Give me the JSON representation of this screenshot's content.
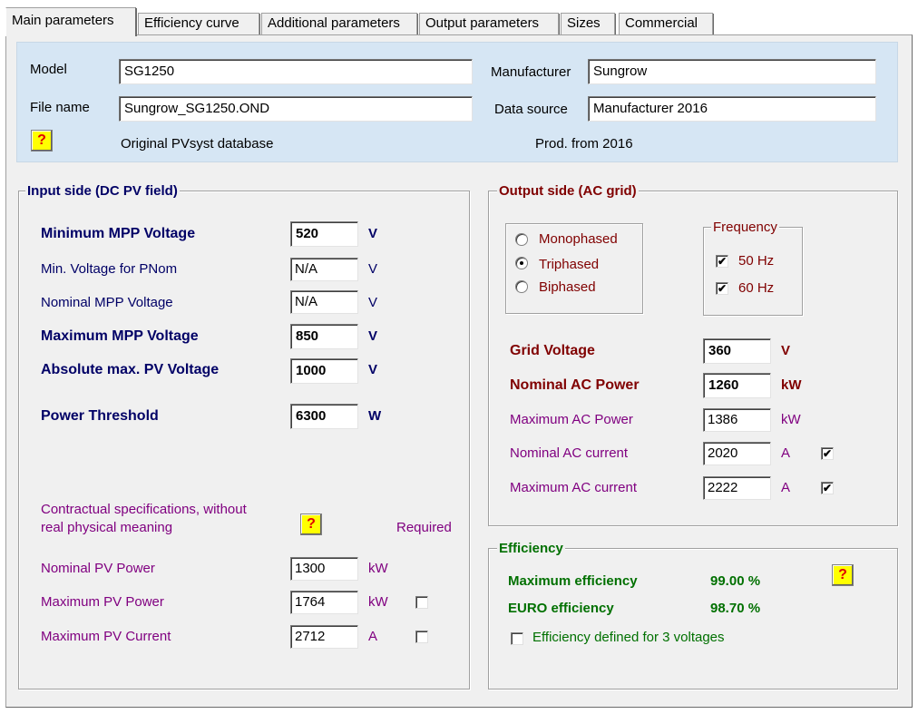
{
  "tabs": [
    {
      "label": "Main parameters"
    },
    {
      "label": "Efficiency curve"
    },
    {
      "label": "Additional parameters"
    },
    {
      "label": "Output parameters"
    },
    {
      "label": "Sizes"
    },
    {
      "label": "Commercial"
    }
  ],
  "header": {
    "model_label": "Model",
    "model_value": "SG1250",
    "manufacturer_label": "Manufacturer",
    "manufacturer_value": "Sungrow",
    "file_label": "File name",
    "file_value": "Sungrow_SG1250.OND",
    "source_label": "Data source",
    "source_value": "Manufacturer 2016",
    "origin_text": "Original PVsyst database",
    "prod_text": "Prod. from 2016",
    "help": "?"
  },
  "input_side": {
    "title": "Input side (DC PV field)",
    "rows": [
      {
        "label": "Minimum MPP Voltage",
        "value": "520",
        "unit": "V"
      },
      {
        "label": "Min. Voltage for PNom",
        "value": "N/A",
        "unit": "V"
      },
      {
        "label": "Nominal  MPP Voltage",
        "value": "N/A",
        "unit": "V"
      },
      {
        "label": "Maximum MPP Voltage",
        "value": "850",
        "unit": "V"
      },
      {
        "label": "Absolute max. PV Voltage",
        "value": "1000",
        "unit": "V"
      },
      {
        "label": "Power Threshold",
        "value": "6300",
        "unit": "W"
      }
    ],
    "contract_text_1": "Contractual specifications,  without",
    "contract_text_2": "real physical meaning",
    "required_label": "Required",
    "help": "?",
    "contract_rows": [
      {
        "label": "Nominal PV Power",
        "value": "1300",
        "unit": "kW"
      },
      {
        "label": "Maximum PV Power",
        "value": "1764",
        "unit": "kW",
        "required": false
      },
      {
        "label": "Maximum PV Current",
        "value": "2712",
        "unit": "A",
        "required": false
      }
    ]
  },
  "output_side": {
    "title": "Output side (AC grid)",
    "phases": [
      {
        "label": "Monophased",
        "selected": false
      },
      {
        "label": "Triphased",
        "selected": true
      },
      {
        "label": "Biphased",
        "selected": false
      }
    ],
    "frequency_title": "Frequency",
    "freq": [
      {
        "label": "50 Hz",
        "checked": true
      },
      {
        "label": "60 Hz",
        "checked": true
      }
    ],
    "rows": [
      {
        "label": "Grid Voltage",
        "value": "360",
        "unit": "V"
      },
      {
        "label": "Nominal AC Power",
        "value": "1260",
        "unit": "kW"
      },
      {
        "label": "Maximum AC Power",
        "value": "1386",
        "unit": "kW"
      },
      {
        "label": "Nominal AC current",
        "value": "2020",
        "unit": "A",
        "checked": true
      },
      {
        "label": "Maximum AC current",
        "value": "2222",
        "unit": "A",
        "checked": true
      }
    ],
    "check_mark": "✔"
  },
  "efficiency": {
    "title": "Efficiency",
    "max_label": "Maximum efficiency",
    "max_value": "99.00 %",
    "euro_label": "EURO efficiency",
    "euro_value": "98.70 %",
    "three_volt_label": "Efficiency defined for 3 voltages",
    "three_volt_checked": false,
    "help": "?"
  }
}
